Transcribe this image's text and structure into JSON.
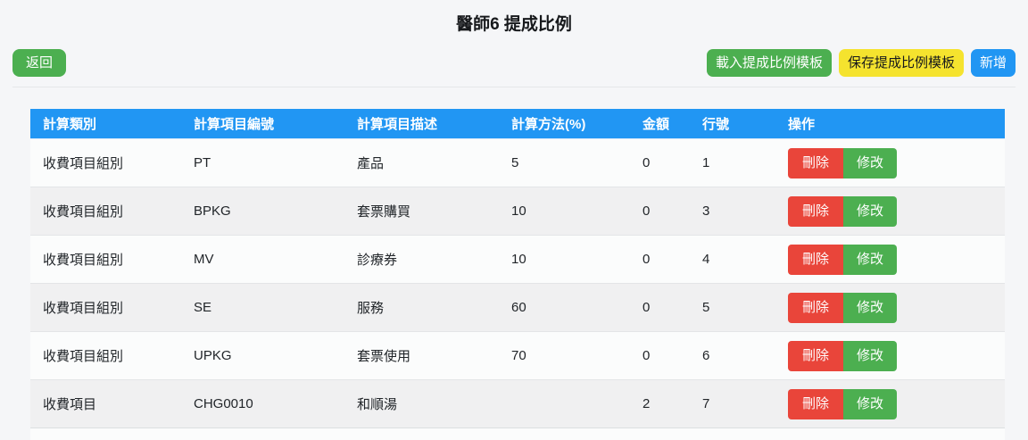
{
  "page": {
    "title": "醫師6 提成比例"
  },
  "toolbar": {
    "back_label": "返回",
    "load_template_label": "載入提成比例模板",
    "save_template_label": "保存提成比例模板",
    "add_label": "新增"
  },
  "colors": {
    "page_bg": "#f5f6f8",
    "header_blue": "#2196f3",
    "button_green": "#4caf50",
    "button_yellow": "#f5e32e",
    "button_blue": "#2196f3",
    "button_red": "#e9453a"
  },
  "table": {
    "columns": [
      "計算類別",
      "計算項目編號",
      "計算項目描述",
      "計算方法(%)",
      "金額",
      "行號",
      "操作"
    ],
    "actions": {
      "delete_label": "刪除",
      "edit_label": "修改"
    },
    "rows": [
      {
        "category": "收費項目組別",
        "item_code": "PT",
        "item_desc": "產品",
        "method_pct": "5",
        "amount": "0",
        "line_no": "1"
      },
      {
        "category": "收費項目組別",
        "item_code": "BPKG",
        "item_desc": "套票購買",
        "method_pct": "10",
        "amount": "0",
        "line_no": "3"
      },
      {
        "category": "收費項目組別",
        "item_code": "MV",
        "item_desc": "診療券",
        "method_pct": "10",
        "amount": "0",
        "line_no": "4"
      },
      {
        "category": "收費項目組別",
        "item_code": "SE",
        "item_desc": "服務",
        "method_pct": "60",
        "amount": "0",
        "line_no": "5"
      },
      {
        "category": "收費項目組別",
        "item_code": "UPKG",
        "item_desc": "套票使用",
        "method_pct": "70",
        "amount": "0",
        "line_no": "6"
      },
      {
        "category": "收費項目",
        "item_code": "CHG0010",
        "item_desc": "和順湯",
        "method_pct": "",
        "amount": "2",
        "line_no": "7"
      }
    ]
  }
}
